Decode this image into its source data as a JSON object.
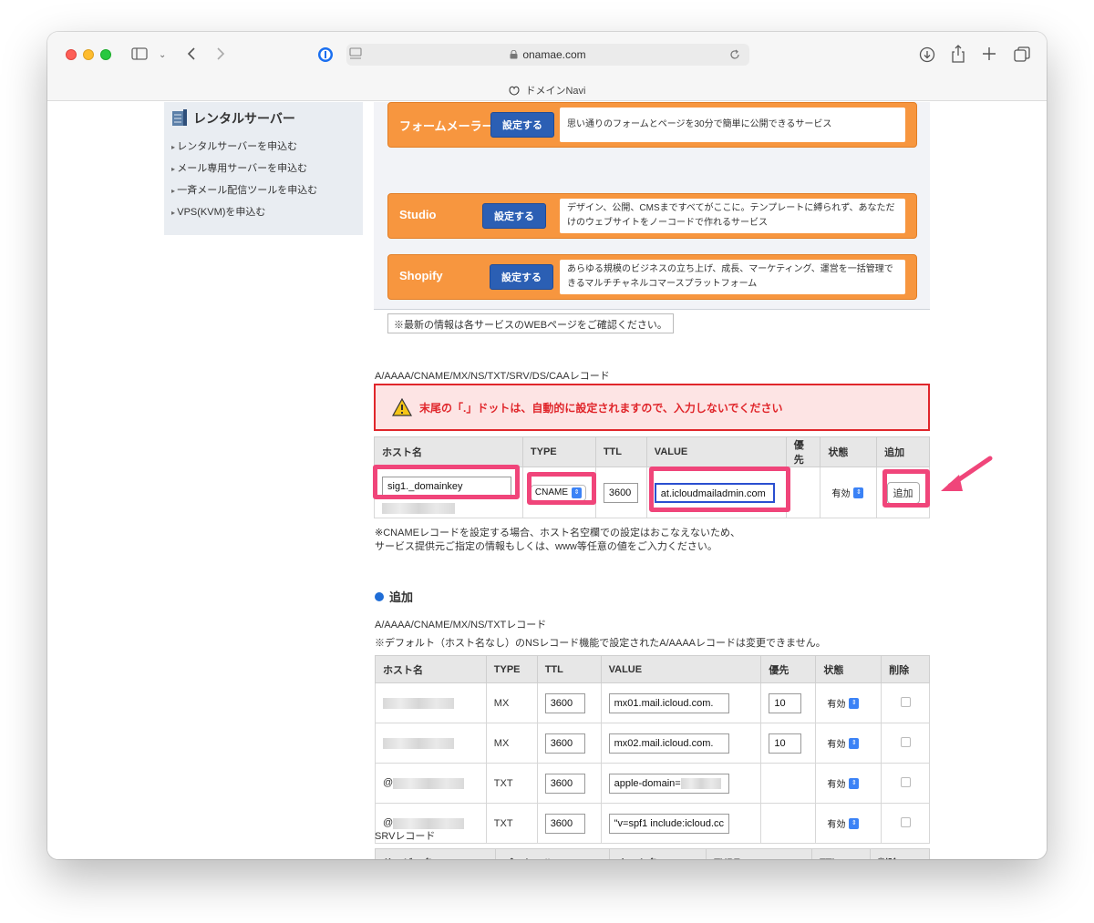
{
  "browser": {
    "url": "onamae.com",
    "tab_title": "ドメインNavi"
  },
  "sidebar": {
    "title": "レンタルサーバー",
    "items": [
      "レンタルサーバーを申込む",
      "メール専用サーバーを申込む",
      "一斉メール配信ツールを申込む",
      "VPS(KVM)を申込む"
    ]
  },
  "services": [
    {
      "name": "フォームメーラー",
      "button": "設定する",
      "desc": "思い通りのフォームとページを30分で簡単に公開できるサービス"
    },
    {
      "name": "Studio",
      "button": "設定する",
      "desc": "デザイン、公開、CMSまですべてがここに。テンプレートに縛られず、あなただけのウェブサイトをノーコードで作れるサービス"
    },
    {
      "name": "Shopify",
      "button": "設定する",
      "desc": "あらゆる規模のビジネスの立ち上げ、成長、マーケティング、運営を一括管理できるマルチチャネルコマースプラットフォーム"
    }
  ],
  "services_note": "※最新の情報は各サービスのWEBページをご確認ください。",
  "record_form": {
    "section_title": "A/AAAA/CNAME/MX/NS/TXT/SRV/DS/CAAレコード",
    "warning": "末尾の「.」ドットは、自動的に設定されますので、入力しないでください",
    "headers": [
      "ホスト名",
      "TYPE",
      "TTL",
      "VALUE",
      "優先",
      "状態",
      "追加"
    ],
    "host_value": "sig1._domainkey",
    "type_value": "CNAME",
    "ttl_value": "3600",
    "value_value": "at.icloudmailadmin.com",
    "state_value": "有効",
    "add_button": "追加"
  },
  "cname_note_lines": [
    "※CNAMEレコードを設定する場合、ホスト名空欄での設定はおこなえないため、",
    "サービス提供元ご指定の情報もしくは、www等任意の値をご入力ください。"
  ],
  "added_section": {
    "heading": "追加",
    "subtitle": "A/AAAA/CNAME/MX/NS/TXTレコード",
    "note": "※デフォルト（ホスト名なし）のNSレコード機能で設定されたA/AAAAレコードは変更できません。",
    "headers": [
      "ホスト名",
      "TYPE",
      "TTL",
      "VALUE",
      "優先",
      "状態",
      "削除"
    ],
    "rows": [
      {
        "host": "",
        "type": "MX",
        "ttl": "3600",
        "value": "mx01.mail.icloud.com.",
        "priority": "10",
        "state": "有効"
      },
      {
        "host": "",
        "type": "MX",
        "ttl": "3600",
        "value": "mx02.mail.icloud.com.",
        "priority": "10",
        "state": "有効"
      },
      {
        "host": "@",
        "type": "TXT",
        "ttl": "3600",
        "value": "apple-domain=",
        "priority": "",
        "state": "有効"
      },
      {
        "host": "@",
        "type": "TXT",
        "ttl": "3600",
        "value": "\"v=spf1 include:icloud.cc",
        "priority": "",
        "state": "有効"
      }
    ]
  },
  "srv_section": {
    "title": "SRVレコード",
    "headers": [
      "サービス名",
      "プロトコル",
      "ホスト名",
      "TYPE",
      "TTL",
      "削除"
    ]
  },
  "colors": {
    "service_orange": "#f7963f",
    "button_blue": "#2b5fb4",
    "warning_red": "#e0262b",
    "highlight_pink": "#f0457a"
  }
}
